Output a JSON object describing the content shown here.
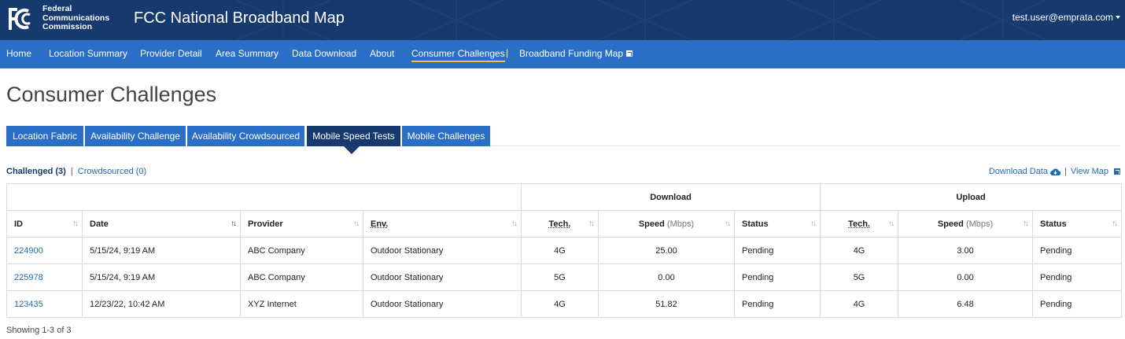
{
  "header": {
    "agency_lines": [
      "Federal",
      "Communications",
      "Commission"
    ],
    "logo_text": "FCC",
    "app_title": "FCC National Broadband Map",
    "user_email": "test.user@emprata.com",
    "colors": {
      "header_bg": "#163a6e",
      "nav_bg": "#2a6ec6",
      "active_underline": "#f5c242"
    }
  },
  "nav": {
    "items": [
      {
        "label": "Home"
      },
      {
        "label": "Location Summary"
      },
      {
        "label": "Provider Detail"
      },
      {
        "label": "Area Summary"
      },
      {
        "label": "Data Download"
      },
      {
        "label": "About"
      },
      {
        "label": "Consumer Challenges",
        "active": true
      }
    ],
    "separator": "|",
    "external_link": {
      "label": "Broadband Funding Map",
      "icon": "external-link-icon"
    }
  },
  "page": {
    "title": "Consumer Challenges"
  },
  "tabs": [
    {
      "label": "Location Fabric"
    },
    {
      "label": "Availability Challenge"
    },
    {
      "label": "Availability Crowdsourced"
    },
    {
      "label": "Mobile Speed Tests",
      "active": true
    },
    {
      "label": "Mobile Challenges"
    }
  ],
  "filters": {
    "challenged": "Challenged (3)",
    "separator": "|",
    "crowdsourced": "Crowdsourced (0)"
  },
  "actions": {
    "download": "Download Data",
    "download_icon": "cloud-download-icon",
    "separator": "|",
    "view_map": "View Map",
    "view_map_icon": "external-link-icon"
  },
  "table": {
    "groups": {
      "download": "Download",
      "upload": "Upload"
    },
    "columns": {
      "id": "ID",
      "date": "Date",
      "provider": "Provider",
      "env": "Env.",
      "dl_tech": "Tech.",
      "dl_speed": "Speed",
      "dl_unit": "(Mbps)",
      "dl_status": "Status",
      "ul_tech": "Tech.",
      "ul_speed": "Speed",
      "ul_unit": "(Mbps)",
      "ul_status": "Status"
    },
    "sort_glyph": "↑↓",
    "rows": [
      {
        "id": "224900",
        "date": "5/15/24, 9:19 AM",
        "provider": "ABC Company",
        "env": "Outdoor Stationary",
        "dl_tech": "4G",
        "dl_speed": "25.00",
        "dl_status": "Pending",
        "ul_tech": "4G",
        "ul_speed": "3.00",
        "ul_status": "Pending"
      },
      {
        "id": "225978",
        "date": "5/15/24, 9:19 AM",
        "provider": "ABC Company",
        "env": "Outdoor Stationary",
        "dl_tech": "5G",
        "dl_speed": "0.00",
        "dl_status": "Pending",
        "ul_tech": "5G",
        "ul_speed": "0.00",
        "ul_status": "Pending"
      },
      {
        "id": "123435",
        "date": "12/23/22, 10:42 AM",
        "provider": "XYZ Internet",
        "env": "Outdoor Stationary",
        "dl_tech": "4G",
        "dl_speed": "51.82",
        "dl_status": "Pending",
        "ul_tech": "4G",
        "ul_speed": "6.48",
        "ul_status": "Pending"
      }
    ]
  },
  "footer": {
    "showing": "Showing 1-3 of 3"
  }
}
